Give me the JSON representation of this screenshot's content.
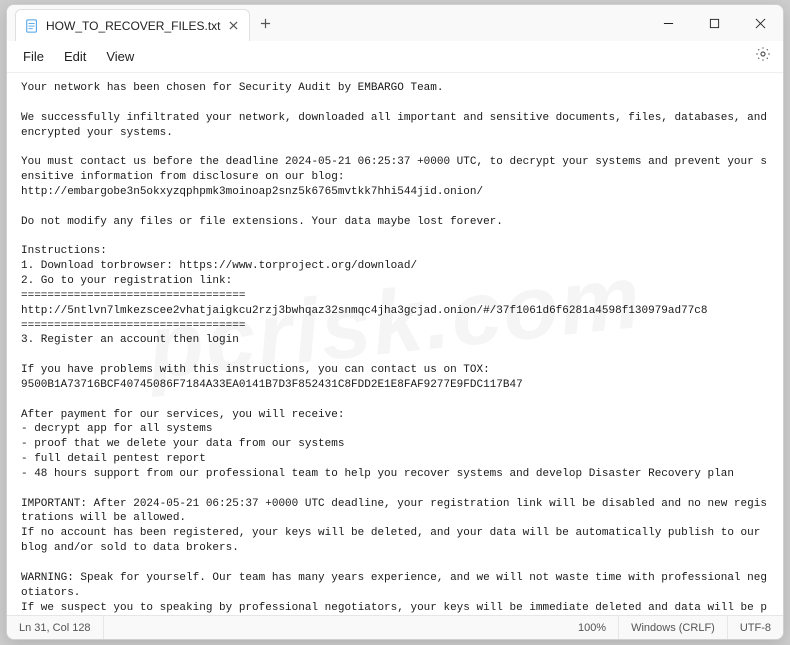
{
  "tab": {
    "title": "HOW_TO_RECOVER_FILES.txt"
  },
  "menu": {
    "file": "File",
    "edit": "Edit",
    "view": "View"
  },
  "content": "Your network has been chosen for Security Audit by EMBARGO Team.\n\nWe successfully infiltrated your network, downloaded all important and sensitive documents, files, databases, and encrypted your systems.\n\nYou must contact us before the deadline 2024-05-21 06:25:37 +0000 UTC, to decrypt your systems and prevent your sensitive information from disclosure on our blog:\nhttp://embargobe3n5okxyzqphpmk3moinoap2snz5k6765mvtkk7hhi544jid.onion/\n\nDo not modify any files or file extensions. Your data maybe lost forever.\n\nInstructions:\n1. Download torbrowser: https://www.torproject.org/download/\n2. Go to your registration link:\n==================================\nhttp://5ntlvn7lmkezscee2vhatjaigkcu2rzj3bwhqaz32snmqc4jha3gcjad.onion/#/37f1061d6f6281a4598f130979ad77c8\n==================================\n3. Register an account then login\n\nIf you have problems with this instructions, you can contact us on TOX:\n9500B1A73716BCF40745086F7184A33EA0141B7D3F852431C8FDD2E1E8FAF9277E9FDC117B47\n\nAfter payment for our services, you will receive:\n- decrypt app for all systems\n- proof that we delete your data from our systems\n- full detail pentest report\n- 48 hours support from our professional team to help you recover systems and develop Disaster Recovery plan\n\nIMPORTANT: After 2024-05-21 06:25:37 +0000 UTC deadline, your registration link will be disabled and no new registrations will be allowed.\nIf no account has been registered, your keys will be deleted, and your data will be automatically publish to our blog and/or sold to data brokers.\n\nWARNING: Speak for yourself. Our team has many years experience, and we will not waste time with professional negotiators.\nIf we suspect you to speaking by professional negotiators, your keys will be immediate deleted and data will be published/sold.",
  "status": {
    "cursor": "Ln 31, Col 128",
    "zoom": "100%",
    "encoding_mode": "Windows (CRLF)",
    "encoding": "UTF-8"
  },
  "watermark": "pcrisk.com"
}
